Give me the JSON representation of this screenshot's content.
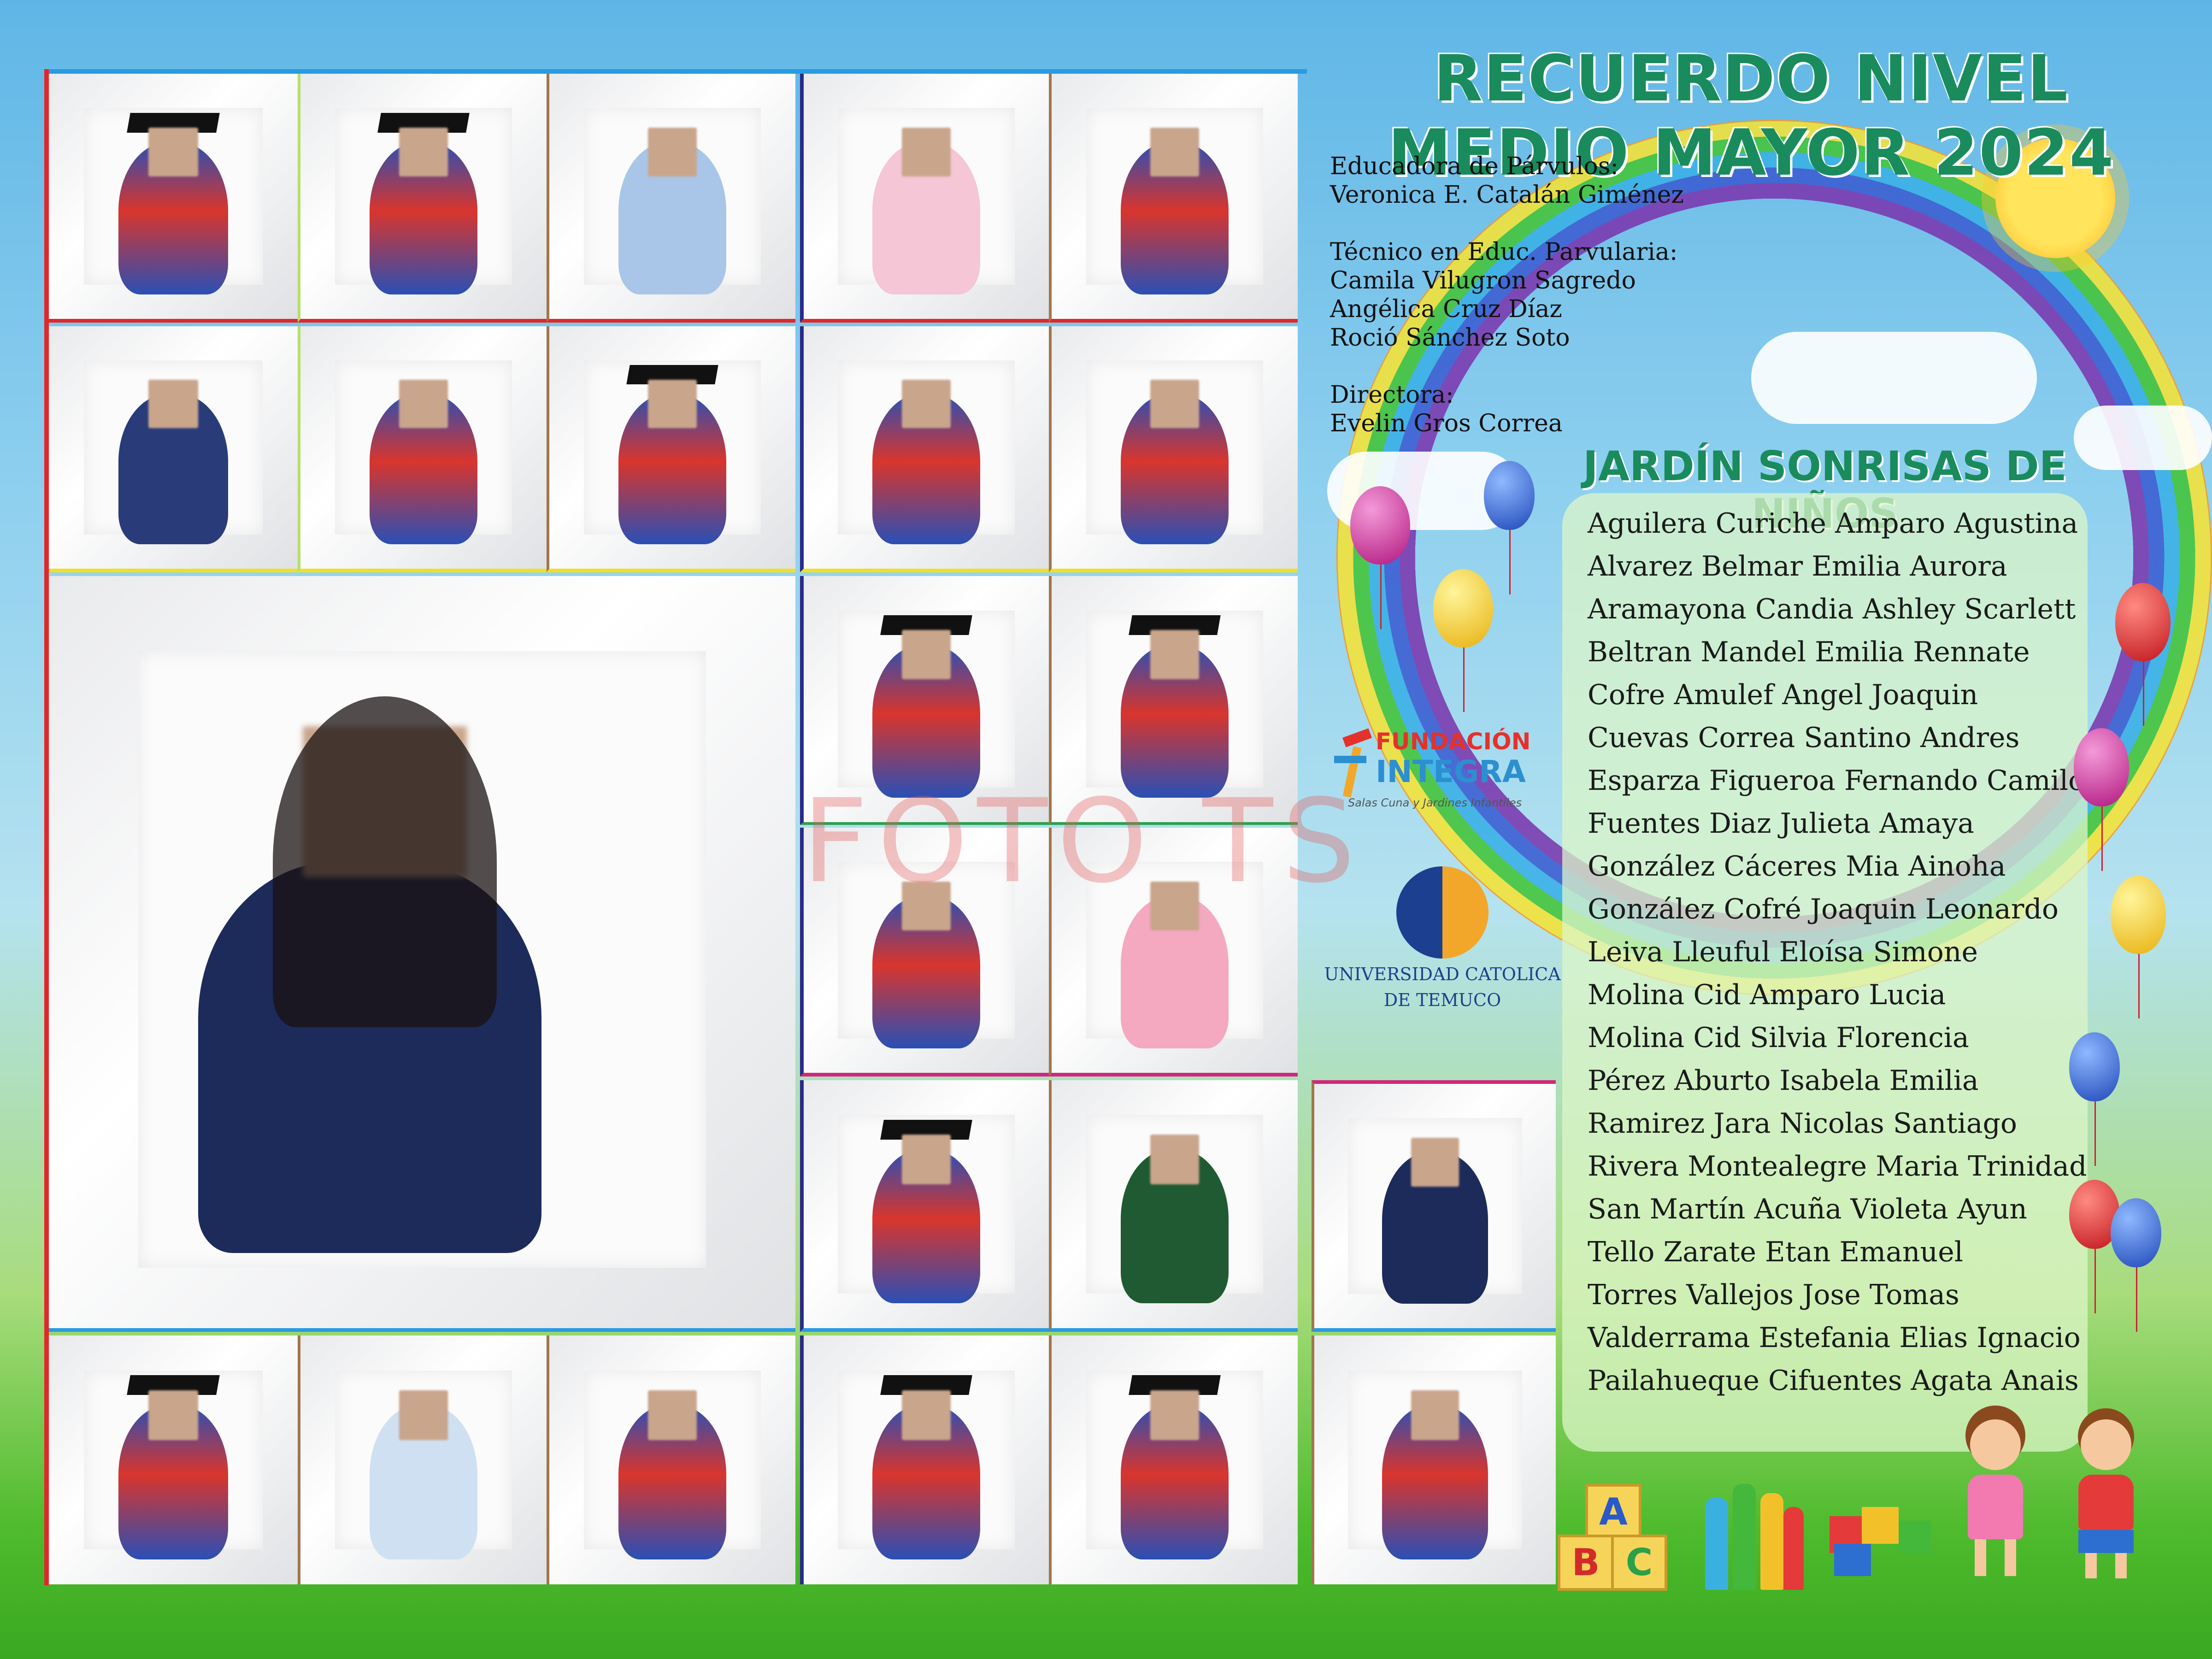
{
  "header": {
    "title": "RECUERDO NIVEL MEDIO MAYOR 2024"
  },
  "staff": {
    "educadora_label": "Educadora de Párvulos:",
    "educadora_name": "Veronica E. Catalán Giménez",
    "tecnico_label": "Técnico en Educ. Parvularia:",
    "tecnico_names": [
      "Camila Vilugron Sagredo",
      "Angélica Cruz Díaz",
      "Roció Sánchez  Soto"
    ],
    "directora_label": "Directora:",
    "directora_name": "Evelin Gros Correa"
  },
  "school_name": "JARDÍN SONRISAS DE NIÑOS",
  "students": [
    "Aguilera  Curiche  Amparo Agustina",
    "Alvarez  Belmar Emilia  Aurora",
    "Aramayona  Candia Ashley Scarlett",
    "Beltran Mandel  Emilia Rennate",
    "Cofre Amulef  Angel Joaquin",
    "Cuevas Correa  Santino Andres",
    "Esparza  Figueroa  Fernando Camilo",
    "Fuentes  Diaz Julieta Amaya",
    "González Cáceres  Mia Ainoha",
    "González Cofré Joaquin Leonardo",
    "Leiva Lleuful Eloísa Simone",
    "Molina Cid Amparo  Lucia",
    "Molina Cid Silvia  Florencia",
    "Pérez Aburto Isabela Emilia",
    "Ramirez Jara  Nicolas Santiago",
    "Rivera  Montealegre  Maria Trinidad",
    "San Martín Acuña  Violeta Ayun",
    "Tello  Zarate  Etan Emanuel",
    "Torres  Vallejos Jose Tomas",
    "Valderrama  Estefania Elias Ignacio",
    "Pailahueque Cifuentes Agata Anais"
  ],
  "logos": {
    "integra_line1": "FUNDACIÓN",
    "integra_line2": "INTEGRA",
    "integra_tagline": "Salas Cuna y Jardines Infantiles",
    "uct_line1": "UNIVERSIDAD CATOLICA",
    "uct_line2": "DE TEMUCO"
  },
  "watermark": "FOTO TS",
  "toys": {
    "blocks": "ABC"
  },
  "colors": {
    "title_green": "#1a8b5c",
    "frame_red": "#e0282a",
    "frame_blue": "#2a9be0",
    "frame_yellow": "#f0e020",
    "frame_navy": "#2b2a8a",
    "frame_brown": "#a0764a",
    "frame_magenta": "#d0287a"
  }
}
